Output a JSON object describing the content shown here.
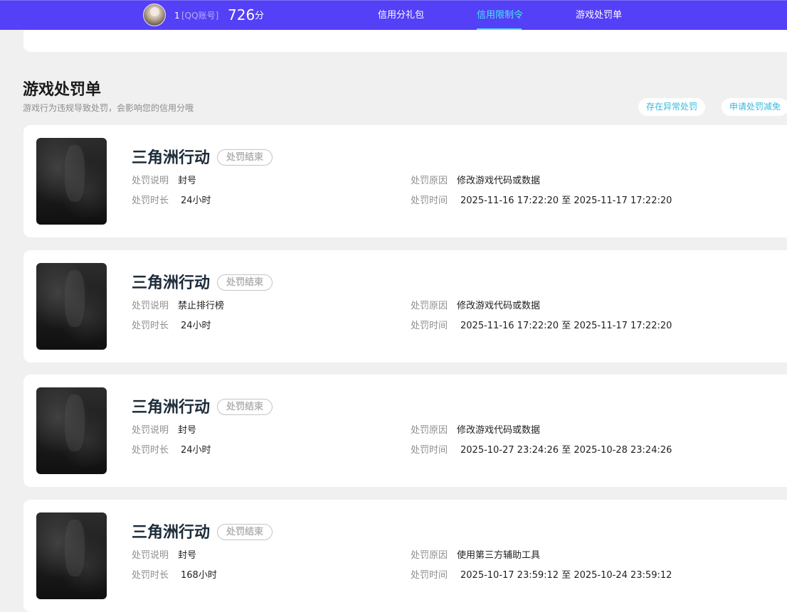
{
  "header": {
    "account_number": "1",
    "account_type": "[QQ账号]",
    "score": "726",
    "score_unit": "分",
    "tabs": [
      {
        "label": "信用分礼包",
        "active": false
      },
      {
        "label": "信用限制令",
        "active": true
      },
      {
        "label": "游戏处罚单",
        "active": false
      }
    ],
    "colors": {
      "bar": "#5440f6",
      "active_tab": "#49e6f4"
    }
  },
  "section": {
    "title": "游戏处罚单",
    "subtitle": "游戏行为违规导致处罚，会影响您的信用分哦",
    "buttons": {
      "abnormal": "存在异常处罚",
      "reduction": "申请处罚减免"
    }
  },
  "labels": {
    "description": "处罚说明",
    "duration": "处罚时长",
    "reason": "处罚原因",
    "time": "处罚时间"
  },
  "penalties": [
    {
      "game": "三角洲行动",
      "status": "处罚结束",
      "description": "封号",
      "duration": "24小时",
      "reason": "修改游戏代码或数据",
      "time": "2025-11-16 17:22:20 至 2025-11-17 17:22:20"
    },
    {
      "game": "三角洲行动",
      "status": "处罚结束",
      "description": "禁止排行榜",
      "duration": "24小时",
      "reason": "修改游戏代码或数据",
      "time": "2025-11-16 17:22:20 至 2025-11-17 17:22:20"
    },
    {
      "game": "三角洲行动",
      "status": "处罚结束",
      "description": "封号",
      "duration": "24小时",
      "reason": "修改游戏代码或数据",
      "time": "2025-10-27 23:24:26 至 2025-10-28 23:24:26"
    },
    {
      "game": "三角洲行动",
      "status": "处罚结束",
      "description": "封号",
      "duration": "168小时",
      "reason": "使用第三方辅助工具",
      "time": "2025-10-17 23:59:12 至 2025-10-24 23:59:12"
    }
  ]
}
